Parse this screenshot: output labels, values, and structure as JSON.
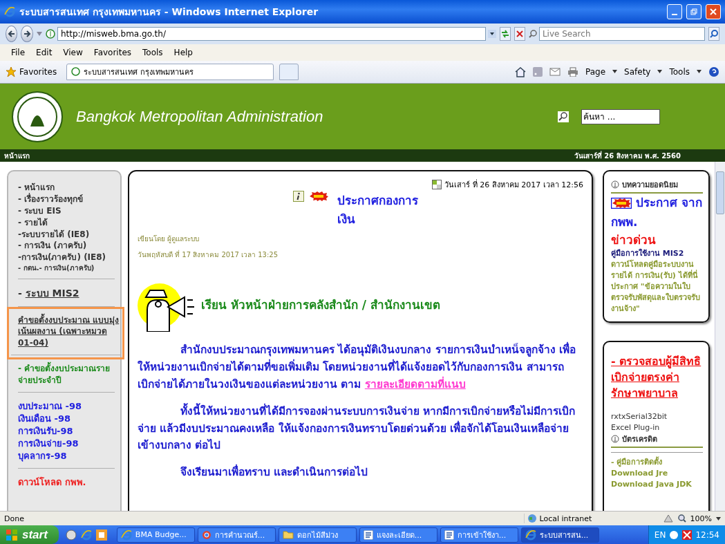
{
  "browser": {
    "title": "ระบบสารสนเทศ กรุงเทพมหานคร - Windows Internet Explorer",
    "address": "http://misweb.bma.go.th/",
    "search_placeholder": "Live Search",
    "menu": [
      "File",
      "Edit",
      "View",
      "Favorites",
      "Tools",
      "Help"
    ],
    "favorites_label": "Favorites",
    "tabs": [
      {
        "label": "ระบบสารสนเทศ กรุงเทพมหานคร",
        "selected": true
      }
    ],
    "toolbar": [
      "Page",
      "Safety",
      "Tools"
    ]
  },
  "header": {
    "title": "Bangkok Metropolitan Administration",
    "search_value": "ค้นหา ..."
  },
  "navbar": {
    "home": "หน้าแรก",
    "date": "วันเสาร์ที่ 26 สิงหาคม พ.ศ. 2560"
  },
  "sidebar": {
    "groups": [
      {
        "kind": "dark",
        "highlighted": false,
        "items": [
          "- หน้าแรก",
          "- เรื่องราวร้องทุกข์",
          "- ระบบ EIS",
          "- รายได้",
          "-ระบบรายได้ (IE8)",
          "- การเงิน (ภาครับ)",
          "-การเงิน(ภาครับ) (IE8)",
          "- กดน.- การเงิน(ภาครับ)"
        ]
      },
      {
        "kind": "link",
        "highlighted": false,
        "prefix": "- ",
        "items": [
          "ระบบ MIS2"
        ]
      },
      {
        "kind": "underline",
        "highlighted": true,
        "items": [
          "คำขอตั้งงบประมาณ แบบมุ่งเน้นผลงาน (เฉพาะหมวด 01-04)"
        ]
      },
      {
        "kind": "green",
        "highlighted": false,
        "items": [
          "- คำขอตั้งงบประมาณรายจ่ายประจำปี"
        ]
      },
      {
        "kind": "blue",
        "highlighted": false,
        "items": [
          "งบประมาณ -98",
          "เงินเดือน -98",
          "การเงินรับ-98",
          "การเงินจ่าย-98",
          "บุคลากร-98"
        ]
      },
      {
        "kind": "red",
        "highlighted": false,
        "items": [
          "ดาวน์โหลด กพพ."
        ]
      }
    ]
  },
  "article": {
    "date": "วันเสาร์ ที่ 26 สิงหาคม 2017 เวลา 12:56",
    "title": "ประกาศกองการเงิน",
    "author": "เขียนโดย ผู้ดูแลระบบ",
    "posted": "วันพฤหัสบดี ที่ 17 สิงหาคม 2017 เวลา 13:25",
    "heading": "เรียน หัวหน้าฝ่ายการคลังสำนัก / สำนักงานเขต",
    "paragraphs": [
      {
        "text": "สำนักงบประมาณกรุงเทพมหานคร ได้อนุมัติเงินงบกลาง รายการเงินบำเหน็จลูกจ้าง เพื่อให้หน่วยงานเบิกจ่ายได้ตามที่ขอเพิ่มเติม โดยหน่วยงานที่ได้แจ้งยอดไว้กับกองการเงิน สามารถเบิกจ่ายได้ภายในวงเงินของแต่ละหน่วยงาน ตาม ",
        "link": "รายละเอียดตามที่แนบ"
      },
      {
        "text": "ทั้งนี้ให้หน่วยงานที่ได้มีการจองผ่านระบบการเงินจ่าย หากมีการเบิกจ่ายหรือไม่มีการเบิกจ่าย แล้วมีงบประมาณคงเหลือ ให้แจ้งกองการเงินทราบโดยด่วนด้วย เพื่อจักได้โอนเงินเหลือจ่ายเข้างบกลาง ต่อไป"
      },
      {
        "text": "จึงเรียนมาเพื่อทราบ และดำเนินการต่อไป"
      }
    ]
  },
  "right": {
    "popular": {
      "heading": "บทความยอดนิยม",
      "items": [
        {
          "kind": "new",
          "text": "ประกาศ จาก กพพ."
        },
        {
          "kind": "urgent",
          "text": "ข่าวด่วน"
        },
        {
          "kind": "navy",
          "text": "คู่มือการใช้งาน MIS2"
        },
        {
          "kind": "olive",
          "text": "ดาวน์โหลดคู่มือระบบงานรายได้ การเงิน(รับ) ได้ที่นี่"
        },
        {
          "kind": "olive",
          "text": "ประกาศ \"ข้อความในใบตรวจรับพัสดุและใบตรวจรับงานจ้าง\""
        }
      ]
    },
    "links": {
      "items": [
        {
          "kind": "redlink",
          "text": "- ตรวจสอบผู้มีสิทธิ เบิกจ่ายตรงค่ารักษาพยาบาล"
        },
        {
          "kind": "dark",
          "text": "rxtxSerial32bit"
        },
        {
          "kind": "dark",
          "text": "Excel Plug-in"
        },
        {
          "kind": "heading",
          "text": "บัตรเครดิต"
        },
        {
          "kind": "olive",
          "text": "- คู่มือการติดตั้ง"
        },
        {
          "kind": "olive",
          "text": "Download Jre"
        },
        {
          "kind": "olive",
          "text": "Download Java JDK"
        }
      ]
    }
  },
  "status_bar": {
    "text": "Done",
    "zone": "Local intranet",
    "zoom": "100%"
  },
  "taskbar": {
    "start": "start",
    "tasks": [
      {
        "kind": "ie",
        "label": "BMA Budge...",
        "selected": false
      },
      {
        "kind": "chrome",
        "label": "การคำนวณร์...",
        "selected": false
      },
      {
        "kind": "folder",
        "label": "ดอกไม้สีม่วง",
        "selected": false
      },
      {
        "kind": "word",
        "label": "แจงละเอียด...",
        "selected": false
      },
      {
        "kind": "word",
        "label": "การเข้าใช้งา...",
        "selected": false
      },
      {
        "kind": "ie",
        "label": "ระบบสารสน...",
        "selected": true
      }
    ],
    "lang": "EN",
    "clock": "12:54"
  }
}
